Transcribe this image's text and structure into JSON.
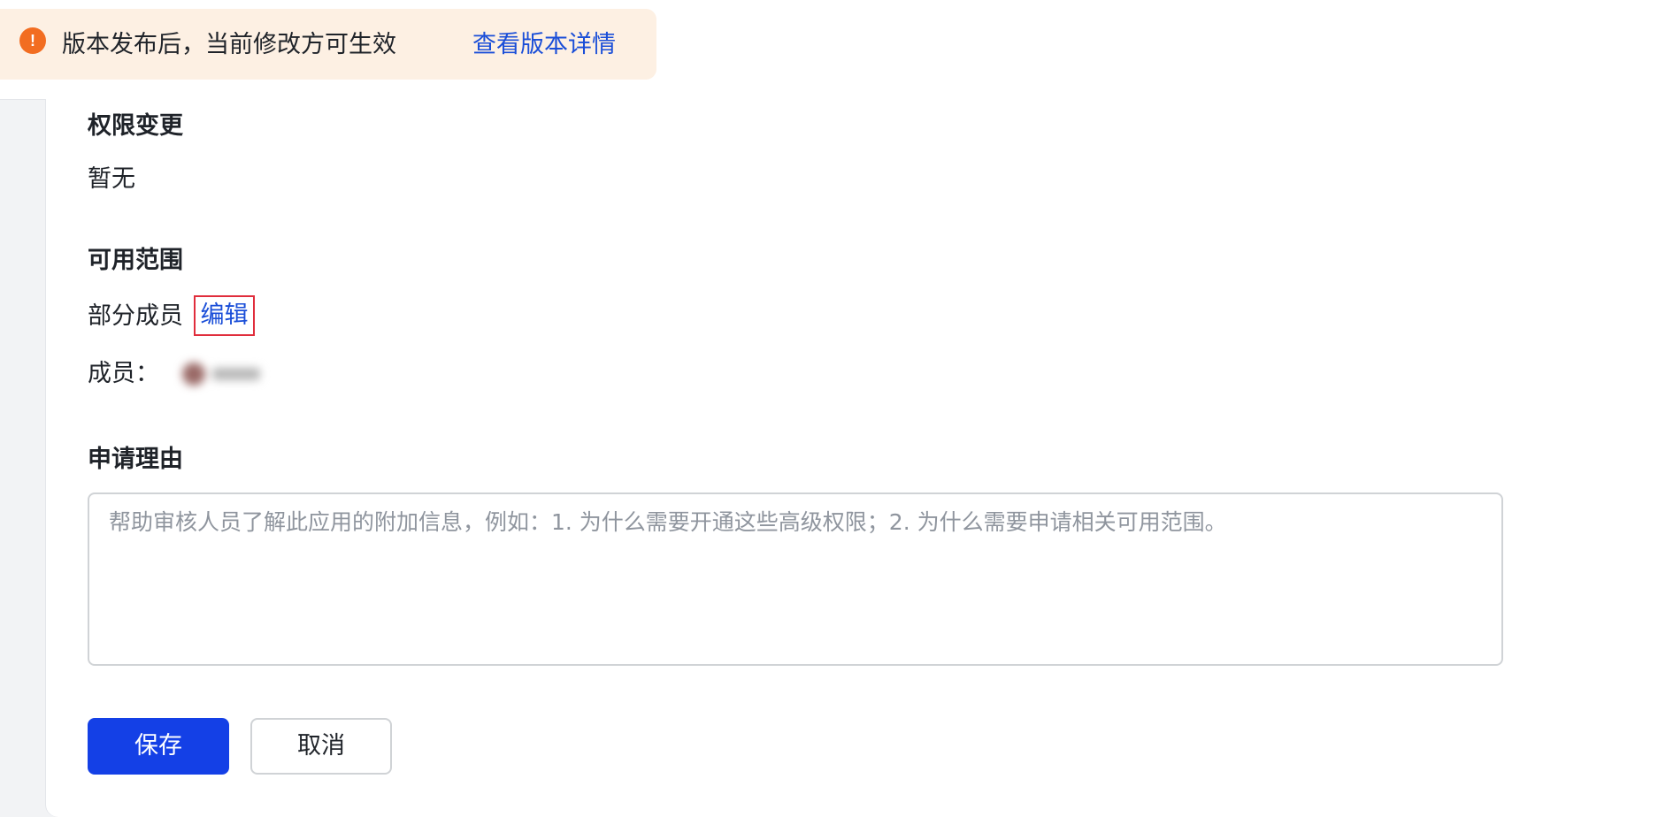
{
  "notice": {
    "icon": "alert-circle-icon",
    "icon_glyph": "!",
    "text": "版本发布后，当前修改方可生效",
    "link": "查看版本详情",
    "background": "#fdf0e3",
    "icon_color": "#f26d21"
  },
  "permissions": {
    "title": "权限变更",
    "value": "暂无"
  },
  "scope": {
    "title": "可用范围",
    "value": "部分成员",
    "edit_label": "编辑",
    "members_label": "成员："
  },
  "reason": {
    "title": "申请理由",
    "placeholder": "帮助审核人员了解此应用的附加信息，例如：1. 为什么需要开通这些高级权限；2. 为什么需要申请相关可用范围。",
    "value": ""
  },
  "actions": {
    "save_label": "保存",
    "cancel_label": "取消",
    "primary_color": "#1440e6",
    "link_color": "#1a4ed8"
  }
}
